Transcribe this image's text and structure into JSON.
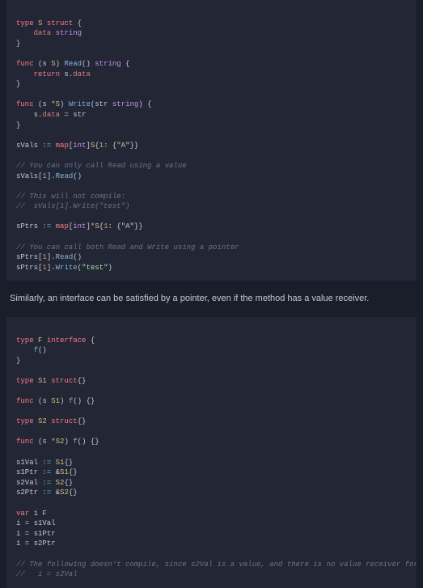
{
  "code_blocks": {
    "a": {
      "l1": "type S struct {",
      "l2": "    data string",
      "l3": "}",
      "l4": "",
      "l5": "func (s S) Read() string {",
      "l6": "    return s.data",
      "l7": "}",
      "l8": "",
      "l9": "func (s *S) Write(str string) {",
      "l10": "    s.data = str",
      "l11": "}",
      "l12": "",
      "l13": "sVals := map[int]S{1: {\"A\"}}",
      "l14": "",
      "l15": "// You can only call Read using a value",
      "l16": "sVals[1].Read()",
      "l17": "",
      "l18": "// This will not compile:",
      "l19": "//  sVals[1].Write(\"test\")",
      "l20": "",
      "l21": "sPtrs := map[int]*S{1: {\"A\"}}",
      "l22": "",
      "l23": "// You can call both Read and Write using a pointer",
      "l24": "sPtrs[1].Read()",
      "l25": "sPtrs[1].Write(\"test\")"
    },
    "b": {
      "l1": "type F interface {",
      "l2": "    f()",
      "l3": "}",
      "l4": "",
      "l5": "type S1 struct{}",
      "l6": "",
      "l7": "func (s S1) f() {}",
      "l8": "",
      "l9": "type S2 struct{}",
      "l10": "",
      "l11": "func (s *S2) f() {}",
      "l12": "",
      "l13": "s1Val := S1{}",
      "l14": "s1Ptr := &S1{}",
      "l15": "s2Val := S2{}",
      "l16": "s2Ptr := &S2{}",
      "l17": "",
      "l18": "var i F",
      "l19": "i = s1Val",
      "l20": "i = s1Ptr",
      "l21": "i = s2Ptr",
      "l22": "",
      "l23": "// The following doesn't compile, since s2Val is a value, and there is no value receiver for f.",
      "l24": "//   i = s2Val"
    }
  },
  "prose": {
    "p1": "Similarly, an interface can be satisfied by a pointer, even if the method has a value receiver."
  },
  "tokens": {
    "type": "type",
    "struct": "struct",
    "func": "func",
    "return": "return",
    "map": "map",
    "var": "var",
    "interface": "interface",
    "int": "int",
    "string": "string",
    "S": "S",
    "F": "F",
    "S1": "S1",
    "S2": "S2",
    "data": "data",
    "str": "str",
    "s": "s",
    "Read": "Read",
    "Write": "Write",
    "f": "f",
    "sVals": "sVals",
    "sPtrs": "sPtrs",
    "s1Val": "s1Val",
    "s1Ptr": "s1Ptr",
    "s2Val": "s2Val",
    "s2Ptr": "s2Ptr",
    "i": "i",
    "A": "\"A\"",
    "test": "\"test\"",
    "one": "1",
    "eq": ":=",
    "assign": "="
  }
}
